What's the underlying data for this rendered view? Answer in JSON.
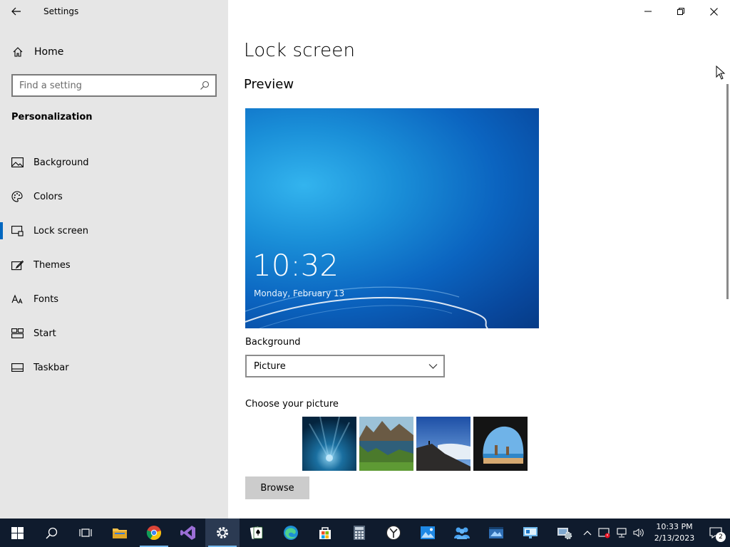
{
  "window": {
    "title": "Settings"
  },
  "sidebar": {
    "home_label": "Home",
    "search_placeholder": "Find a setting",
    "section_title": "Personalization",
    "items": [
      {
        "label": "Background",
        "icon": "picture-icon"
      },
      {
        "label": "Colors",
        "icon": "palette-icon"
      },
      {
        "label": "Lock screen",
        "icon": "lock-screen-icon",
        "active": true
      },
      {
        "label": "Themes",
        "icon": "themes-icon"
      },
      {
        "label": "Fonts",
        "icon": "fonts-icon"
      },
      {
        "label": "Start",
        "icon": "start-icon"
      },
      {
        "label": "Taskbar",
        "icon": "taskbar-icon"
      }
    ]
  },
  "main": {
    "title": "Lock screen",
    "preview_title": "Preview",
    "preview_time": "10:32",
    "preview_date": "Monday, February 13",
    "background_label": "Background",
    "background_value": "Picture",
    "choose_label": "Choose your picture",
    "browse_label": "Browse"
  },
  "taskbar": {
    "time": "10:33 PM",
    "date": "2/13/2023",
    "notification_count": "2"
  },
  "colors": {
    "accent": "#0067c0",
    "sidebar_bg": "#e6e6e6",
    "taskbar_bg": "#0f1b2d"
  }
}
